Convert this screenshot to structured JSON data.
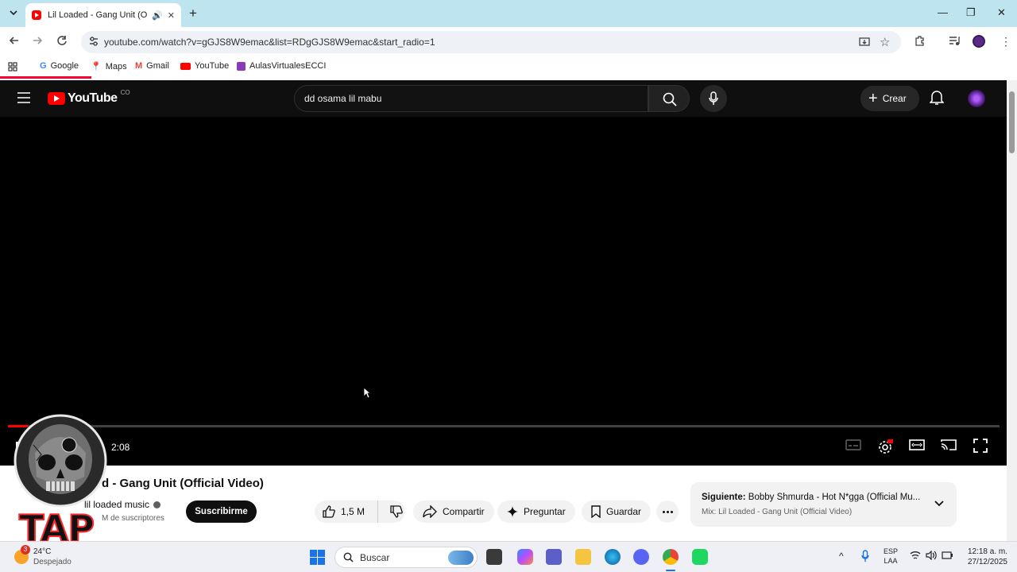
{
  "browser": {
    "tab_title": "Lil Loaded - Gang Unit (Offi",
    "url": "youtube.com/watch?v=gGJS8W9emac&list=RDgGJS8W9emac&start_radio=1",
    "bookmarks": [
      "Google",
      "Maps",
      "Gmail",
      "YouTube",
      "AulasVirtualesECCI"
    ],
    "page_load_progress_pct": 9
  },
  "youtube": {
    "logo_text": "YouTube",
    "country_code": "CO",
    "search_query": "dd osama lil mabu",
    "create_label": "Crear"
  },
  "player": {
    "time_text": "2:08",
    "progress_pct": 2
  },
  "video": {
    "title_visible": "d - Gang Unit (Official Video)",
    "channel_name": "lil loaded music",
    "subscribers_visible": "M de suscriptores",
    "subscribe_label": "Suscribirme",
    "like_count": "1,5 M",
    "share_label": "Compartir",
    "ask_label": "Preguntar",
    "save_label": "Guardar"
  },
  "up_next": {
    "prefix": "Siguiente:",
    "title": "Bobby Shmurda - Hot N*gga (Official Mu...",
    "mix": "Mix: Lil Loaded - Gang Unit (Official Video)"
  },
  "overlay": {
    "logo_text": "TAP"
  },
  "taskbar": {
    "weather_temp": "24°C",
    "weather_desc": "Despejado",
    "weather_badge": "3",
    "search_placeholder": "Buscar",
    "lang_top": "ESP",
    "lang_bottom": "LAA",
    "time": "12:18 a. m.",
    "date": "27/12/2025"
  },
  "colors": {
    "youtube_red": "#ff0000",
    "tab_strip": "#bde4ef"
  }
}
